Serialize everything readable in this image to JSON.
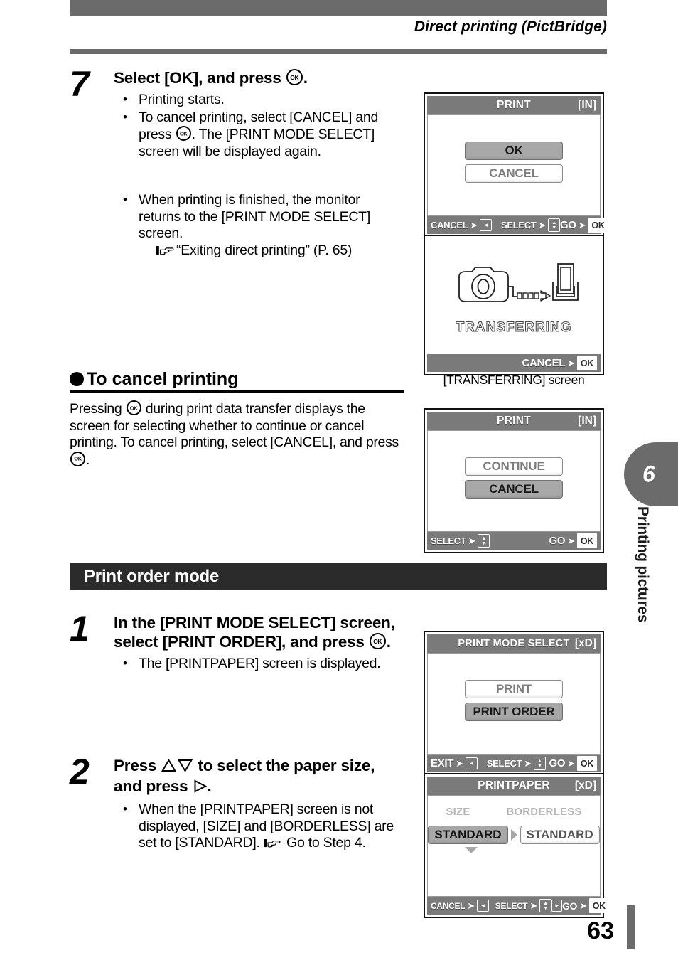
{
  "header": {
    "running_title": "Direct printing (PictBridge)"
  },
  "steps": [
    {
      "number": "7",
      "title_pre": "Select [OK], and press ",
      "title_post": ".",
      "bullets": [
        "Printing starts.",
        "To cancel printing, select [CANCEL] and press ",
        ". The [PRINT MODE SELECT] screen will be displayed again."
      ],
      "bullet2": {
        "line1": "When printing is finished, the monitor returns to the [PRINT MODE SELECT] screen.",
        "ref": "“Exiting direct printing” (P. 65)"
      }
    },
    {
      "number": "1",
      "title": "In the [PRINT MODE SELECT] screen, select [PRINT ORDER], and press ",
      "title_post": ".",
      "bullet": "The [PRINTPAPER] screen is displayed."
    },
    {
      "number": "2",
      "title_a": "Press ",
      "title_b": " to select the paper size, and press ",
      "title_post": ".",
      "bullet_a": "When the [PRINTPAPER] screen is not displayed, [SIZE] and [BORDERLESS] are set to [STANDARD]. ",
      "bullet_b": " Go to Step 4."
    }
  ],
  "cancel_section": {
    "heading": "To cancel printing",
    "body_a": "Pressing ",
    "body_b": " during print data transfer displays the screen for selecting whether to continue or cancel printing. To cancel printing, select [CANCEL], and press ",
    "body_c": "."
  },
  "section_bar": {
    "title": "Print order mode"
  },
  "index_tab": {
    "number": "6",
    "label": "Printing pictures"
  },
  "page_number": "63",
  "screens": {
    "print_ok": {
      "title": "PRINT",
      "card": "[IN]",
      "options": [
        {
          "label": "OK",
          "selected": true
        },
        {
          "label": "CANCEL",
          "selected": false
        }
      ],
      "footer": [
        {
          "label": "CANCEL",
          "key": "◂",
          "type": "box"
        },
        {
          "label": "SELECT",
          "key": "updown",
          "type": "updown"
        },
        {
          "label": "GO",
          "key": "OK",
          "type": "ok"
        }
      ]
    },
    "transferring": {
      "status": "TRANSFERRING",
      "footer": [
        {
          "label": "CANCEL",
          "key": "OK",
          "type": "ok"
        }
      ],
      "caption": "[TRANSFERRING] screen"
    },
    "print_continue": {
      "title": "PRINT",
      "card": "[IN]",
      "options": [
        {
          "label": "CONTINUE",
          "selected": false
        },
        {
          "label": "CANCEL",
          "selected": true
        }
      ],
      "footer": [
        {
          "label": "SELECT",
          "key": "updown",
          "type": "updown"
        },
        {
          "label": "GO",
          "key": "OK",
          "type": "ok"
        }
      ]
    },
    "print_mode_select": {
      "title": "PRINT MODE SELECT",
      "card": "[xD]",
      "options": [
        {
          "label": "PRINT",
          "selected": false
        },
        {
          "label": "PRINT ORDER",
          "selected": true
        }
      ],
      "footer": [
        {
          "label": "EXIT",
          "key": "◂",
          "type": "box"
        },
        {
          "label": "SELECT",
          "key": "updown",
          "type": "updown"
        },
        {
          "label": "GO",
          "key": "OK",
          "type": "ok"
        }
      ]
    },
    "printpaper": {
      "title": "PRINTPAPER",
      "card": "[xD]",
      "col_labels": [
        "SIZE",
        "BORDERLESS"
      ],
      "values": [
        {
          "label": "STANDARD",
          "selected": true
        },
        {
          "label": "STANDARD",
          "selected": false
        }
      ],
      "footer": [
        {
          "label": "CANCEL",
          "key": "◂",
          "type": "box"
        },
        {
          "label": "SELECT",
          "key": "updownright",
          "type": "updownright"
        },
        {
          "label": "GO",
          "key": "OK",
          "type": "ok"
        }
      ]
    }
  },
  "colors": {
    "rule_gray": "#6b6b6b",
    "section_bar": "#2b2b2b",
    "lcd_chrome": "#7a7a7a",
    "lcd_selected": "#a8a8a8"
  }
}
